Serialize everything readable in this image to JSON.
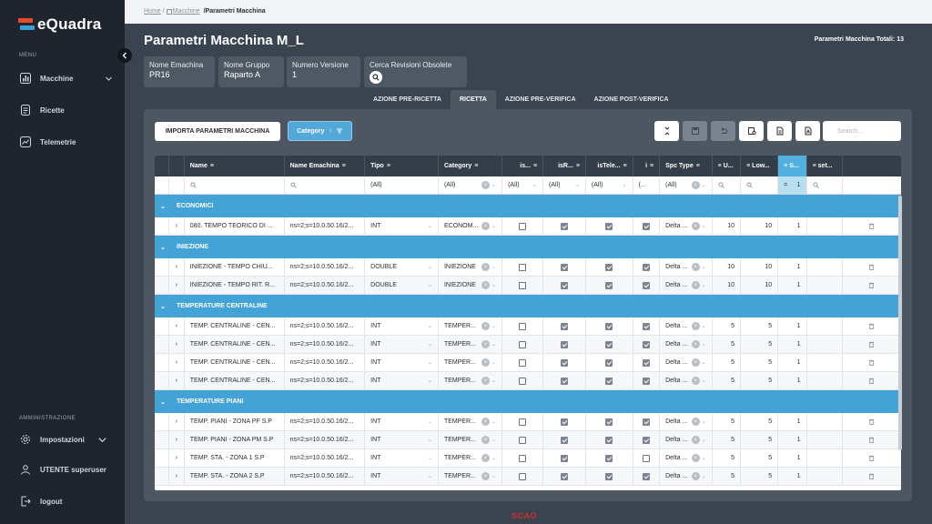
{
  "app": {
    "brand": "eQuadra",
    "brand_colors": {
      "top": "#e94b2e",
      "bottom": "#3a9fd1"
    }
  },
  "sidebar": {
    "menu_label": "MENU",
    "items": [
      {
        "label": "Macchine",
        "icon": "bar-chart-icon"
      },
      {
        "label": "Ricette",
        "icon": "document-icon"
      },
      {
        "label": "Telemetrie",
        "icon": "line-chart-icon"
      }
    ],
    "admin_label": "AMMINISTRAZIONE",
    "admin_items": [
      {
        "label": "Impostazioni",
        "icon": "gear-icon"
      },
      {
        "label": "UTENTE superuser",
        "icon": "user-icon"
      },
      {
        "label": "logout",
        "icon": "logout-icon"
      }
    ]
  },
  "breadcrumb": {
    "home": "Home",
    "sep1": "/",
    "machines": "Macchine",
    "current": "/Parametri Macchina"
  },
  "page": {
    "title": "Parametri Macchina M_L",
    "total": "Parametri Macchina Totali: 13"
  },
  "info_cards": [
    {
      "label": "Nome Emachina",
      "value": "PR16"
    },
    {
      "label": "Nome Gruppo",
      "value": "Raparto A"
    },
    {
      "label": "Numero Versione",
      "value": "1"
    },
    {
      "label": "Cerca Revisioni Obsolete",
      "value": ""
    }
  ],
  "tabs": [
    "AZIONE PRE-RICETTA",
    "RICETTA",
    "AZIONE PRE-VERIFICA",
    "AZIONE POST-VERIFICA"
  ],
  "active_tab": "RICETTA",
  "toolbar": {
    "import_label": "IMPORTA PARAMETRI MACCHINA",
    "category_label": "Category",
    "search_placeholder": "Search..."
  },
  "grid": {
    "columns": [
      "Name",
      "Name Emachina",
      "Tipo",
      "Category",
      "is...",
      "isR...",
      "isTele...",
      "i",
      "Spc Type",
      "U...",
      "Low...",
      "S...",
      "set..."
    ],
    "filters": {
      "tipo": "(All)",
      "category": "(All)",
      "is": "(All)",
      "isr": "(All)",
      "istele": "(All)",
      "i": "(...",
      "spc": "(All)",
      "s": "1"
    },
    "filter_op": "=",
    "groups": [
      {
        "label": "ECONOMICI",
        "rows": [
          {
            "name": "080. TEMPO TEORICO DI ...",
            "emachina": "ns=2;s=10.0.50.16/2...",
            "tipo": "INT",
            "category": "ECONOM...",
            "is": false,
            "isr": true,
            "istele": true,
            "i": true,
            "spc": "Delta ...",
            "u": "10",
            "low": "10",
            "s": "1"
          }
        ]
      },
      {
        "label": "INIEZIONE",
        "rows": [
          {
            "name": "INIEZIONE - TEMPO CHIU...",
            "emachina": "ns=2;s=10.0.50.16/2...",
            "tipo": "DOUBLE",
            "category": "INIEZIONE",
            "is": false,
            "isr": true,
            "istele": true,
            "i": true,
            "spc": "Delta ...",
            "u": "10",
            "low": "10",
            "s": "1"
          },
          {
            "name": "INIEZIONE - TEMPO RIT. R...",
            "emachina": "ns=2;s=10.0.50.16/2...",
            "tipo": "DOUBLE",
            "category": "INIEZIONE",
            "is": false,
            "isr": true,
            "istele": true,
            "i": true,
            "spc": "Delta ...",
            "u": "10",
            "low": "10",
            "s": "1"
          }
        ]
      },
      {
        "label": "TEMPERATURE CENTRALINE",
        "rows": [
          {
            "name": "TEMP. CENTRALINE - CEN...",
            "emachina": "ns=2;s=10.0.50.16/2...",
            "tipo": "INT",
            "category": "TEMPER...",
            "is": false,
            "isr": true,
            "istele": true,
            "i": true,
            "spc": "Delta ...",
            "u": "5",
            "low": "5",
            "s": "1"
          },
          {
            "name": "TEMP. CENTRALINE - CEN...",
            "emachina": "ns=2;s=10.0.50.16/2...",
            "tipo": "INT",
            "category": "TEMPER...",
            "is": false,
            "isr": true,
            "istele": true,
            "i": true,
            "spc": "Delta ...",
            "u": "5",
            "low": "5",
            "s": "1"
          },
          {
            "name": "TEMP. CENTRALINE - CEN...",
            "emachina": "ns=2;s=10.0.50.16/2...",
            "tipo": "INT",
            "category": "TEMPER...",
            "is": false,
            "isr": true,
            "istele": true,
            "i": true,
            "spc": "Delta ...",
            "u": "5",
            "low": "5",
            "s": "1"
          },
          {
            "name": "TEMP. CENTRALINE - CEN...",
            "emachina": "ns=2;s=10.0.50.16/2...",
            "tipo": "INT",
            "category": "TEMPER...",
            "is": false,
            "isr": true,
            "istele": true,
            "i": true,
            "spc": "Delta ...",
            "u": "5",
            "low": "5",
            "s": "1"
          }
        ]
      },
      {
        "label": "TEMPERATURE PIANI",
        "rows": [
          {
            "name": "TEMP. PIANI - ZONA PF S.P",
            "emachina": "ns=2;s=10.0.50.16/2...",
            "tipo": "INT",
            "category": "TEMPER...",
            "is": false,
            "isr": true,
            "istele": true,
            "i": true,
            "spc": "Delta ...",
            "u": "5",
            "low": "5",
            "s": "1"
          },
          {
            "name": "TEMP. PIANI - ZONA PM S.P",
            "emachina": "ns=2;s=10.0.50.16/2...",
            "tipo": "INT",
            "category": "TEMPER...",
            "is": false,
            "isr": true,
            "istele": true,
            "i": true,
            "spc": "Delta ...",
            "u": "5",
            "low": "5",
            "s": "1"
          },
          {
            "name": "TEMP. STA. - ZONA 1 S.P",
            "emachina": "ns=2;s=10.0.50.16/2...",
            "tipo": "INT",
            "category": "TEMPER...",
            "is": false,
            "isr": true,
            "istele": true,
            "i": false,
            "spc": "Delta ...",
            "u": "5",
            "low": "5",
            "s": "1"
          },
          {
            "name": "TEMP. STA. - ZONA 2 S.P",
            "emachina": "ns=2;s=10.0.50.16/2...",
            "tipo": "INT",
            "category": "TEMPER...",
            "is": false,
            "isr": true,
            "istele": true,
            "i": true,
            "spc": "Delta ...",
            "u": "5",
            "low": "5",
            "s": "1"
          }
        ]
      }
    ]
  },
  "footer": {
    "logo": "SCAO",
    "color": "#d0312d"
  }
}
